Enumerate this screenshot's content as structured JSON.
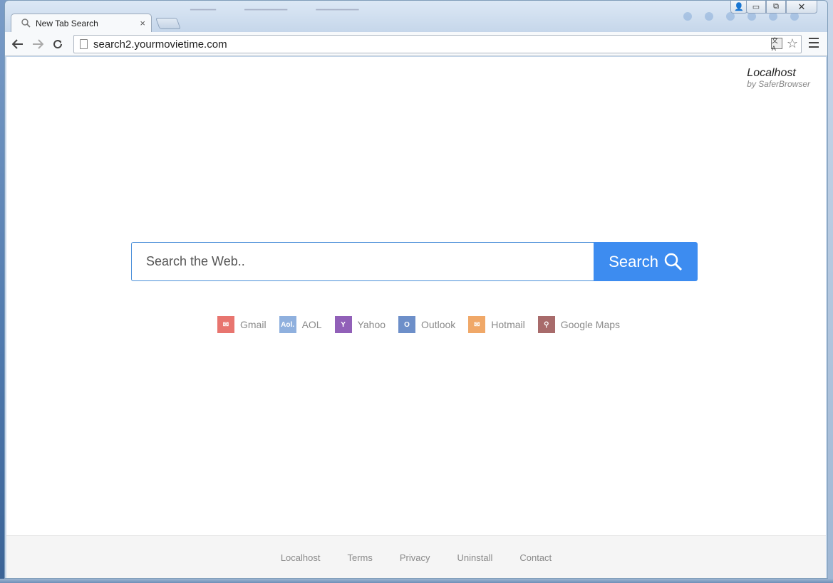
{
  "tab": {
    "title": "New Tab Search",
    "close": "×"
  },
  "toolbar": {
    "back": "←",
    "forward": "→",
    "reload": "↻",
    "url": "search2.yourmovietime.com",
    "star": "☆",
    "translate": "文A"
  },
  "window": {
    "minimize": "▭",
    "maximize": "⧉",
    "close": "✕",
    "user": "👤"
  },
  "brand": {
    "name": "Localhost",
    "by": "by SaferBrowser"
  },
  "search": {
    "placeholder": "Search the Web..",
    "button_label": "Search"
  },
  "quick_links": [
    {
      "label": "Gmail",
      "icon": "gmail-icon",
      "color": "#e8756f",
      "glyph": "✉"
    },
    {
      "label": "AOL",
      "icon": "aol-icon",
      "color": "#8fb0de",
      "glyph": "Aol."
    },
    {
      "label": "Yahoo",
      "icon": "yahoo-icon",
      "color": "#9160b8",
      "glyph": "Y"
    },
    {
      "label": "Outlook",
      "icon": "outlook-icon",
      "color": "#6d8fc9",
      "glyph": "O"
    },
    {
      "label": "Hotmail",
      "icon": "hotmail-icon",
      "color": "#f0a868",
      "glyph": "✉"
    },
    {
      "label": "Google Maps",
      "icon": "maps-icon",
      "color": "#a86b6b",
      "glyph": "⚲"
    }
  ],
  "footer": {
    "localhost": "Localhost",
    "terms": "Terms",
    "privacy": "Privacy",
    "uninstall": "Uninstall",
    "contact": "Contact"
  }
}
